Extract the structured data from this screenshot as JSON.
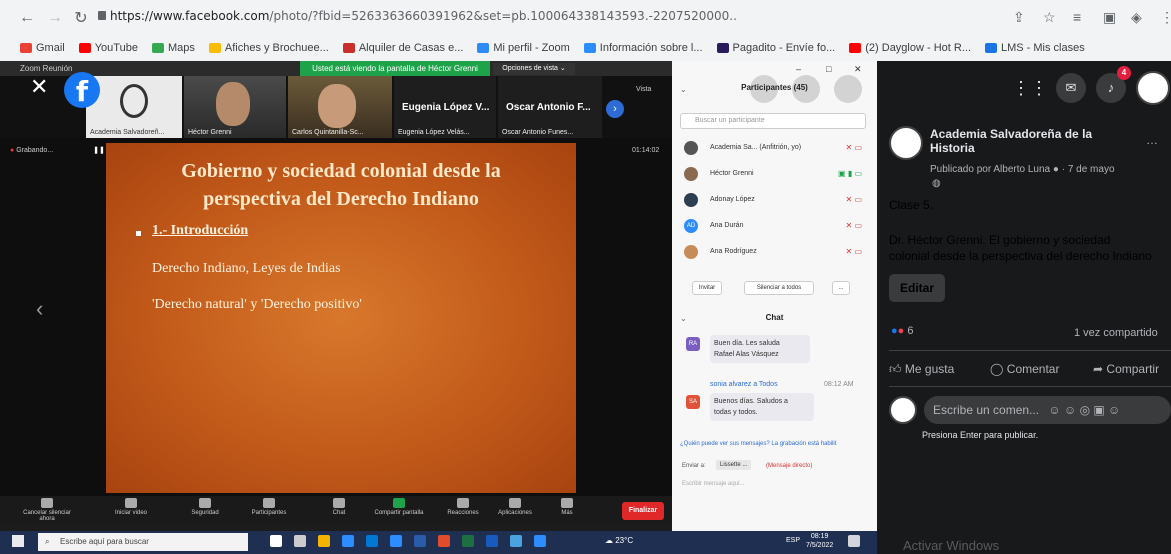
{
  "browser": {
    "url_host": "https://www.facebook.com",
    "url_path": "/photo/?fbid=5263363660391962&set=pb.100064338143593.-2207520000..",
    "bookmarks": [
      {
        "label": "Gmail",
        "color": "#ea4335"
      },
      {
        "label": "YouTube",
        "color": "#ff0000"
      },
      {
        "label": "Maps",
        "color": "#34a853"
      },
      {
        "label": "Afiches y Brochuee...",
        "color": "#fbbc04"
      },
      {
        "label": "Alquiler de Casas e...",
        "color": "#c9302c"
      },
      {
        "label": "Mi perfil - Zoom",
        "color": "#2d8cff"
      },
      {
        "label": "Información sobre l...",
        "color": "#2d8cff"
      },
      {
        "label": "Pagadito - Envíe fo...",
        "color": "#2a1b5e"
      },
      {
        "label": "(2) Dayglow - Hot R...",
        "color": "#ff0000"
      },
      {
        "label": "LMS - Mis clases",
        "color": "#1a73e8"
      }
    ]
  },
  "zoom": {
    "window_title": "Zoom Reunión",
    "share_banner": "Usted está viendo la pantalla de Héctor Grenni",
    "view_options": "Opciones de vista ⌄",
    "thumbnails": [
      "Academia Salvadoreñ...",
      "Héctor Grenni",
      "Carlos Quintanilla-Sc...",
      "Eugenia López Velás...",
      "Oscar Antonio Funes..."
    ],
    "big_names": [
      "Eugenia López V...",
      "Oscar Antonio F..."
    ],
    "view_label": "Vista",
    "slide": {
      "title_line1": "Gobierno y sociedad colonial desde la",
      "title_line2": "perspectiva del Derecho Indiano",
      "bullet": "1.- Introducción",
      "line1": "Derecho Indiano, Leyes de Indias",
      "line2": "'Derecho natural' y 'Derecho positivo'"
    },
    "recording_label": "Grabando...",
    "elapsed": "01:14:02",
    "controls": [
      "Cancelar silenciar ahora",
      "Iniciar video",
      "Seguridad",
      "Participantes",
      "Chat",
      "Compartir pantalla",
      "Reacciones",
      "Aplicaciones",
      "Más"
    ],
    "participants_count": "45",
    "end_button": "Finalizar"
  },
  "participants": {
    "header": "Participantes (45)",
    "search_placeholder": "Buscar un participante",
    "rows": [
      {
        "name": "Academia Sa... (Anfitrión, yo)",
        "color": "#555"
      },
      {
        "name": "Héctor Grenni",
        "color": "#8a6a50"
      },
      {
        "name": "Adonay López",
        "color": "#2d3e50"
      },
      {
        "name": "Ana Durán",
        "color": "#2d8cff",
        "initials": "AD"
      },
      {
        "name": "Ana Rodríguez",
        "color": "#c68b5a"
      }
    ],
    "invite_button": "Invitar",
    "mute_all_button": "Silenciar a todos",
    "more_button": "..."
  },
  "chat": {
    "title": "Chat",
    "messages": [
      {
        "initials": "RA",
        "color": "#7a5fc0",
        "text1": "Buen día. Les saluda",
        "text2": "Rafael Alas Vásquez"
      },
      {
        "sender": "sonia alvarez a Todos",
        "time": "08:12 AM",
        "initials": "SA",
        "color": "#e0523a",
        "text1": "Buenos días. Saludos a",
        "text2": "todas y todos."
      }
    ],
    "notice": "¿Quién puede ver sus mensajes? La grabación está habilit",
    "send_to_label": "Enviar a:",
    "send_to_value": "Lissette ...",
    "direct_message": "(Mensaje directo)",
    "input_placeholder": "Escribir mensaje aquí..."
  },
  "facebook": {
    "notification_count": "4",
    "page_name_line1": "Academia Salvadoreña de la",
    "page_name_line2": "Historia",
    "published_by": "Publicado por Alberto Luna",
    "date": "7 de mayo",
    "post_line1": "Clase 5.",
    "post_line2": "Dr. Héctor Grenni. El gobierno y sociedad",
    "post_line3": "colonial desde la perspectiva del derecho Indiano",
    "edit_button": "Editar",
    "reactions_count": "6",
    "shares": "1 vez compartido",
    "like_button": "Me gusta",
    "comment_button": "Comentar",
    "share_button": "Compartir",
    "comment_placeholder": "Escribe un comen...",
    "press_enter": "Presiona Enter para publicar."
  },
  "taskbar": {
    "search_placeholder": "Escribe aquí para buscar",
    "temperature": "23°C",
    "language": "ESP",
    "time": "08:19",
    "date": "7/5/2022",
    "watermark": "Activar Windows"
  }
}
